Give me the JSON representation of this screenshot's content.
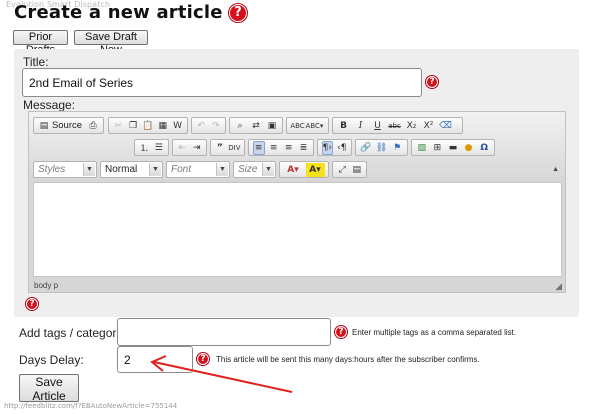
{
  "page": {
    "title": "Create a new article",
    "watermark": "Evolution Smart Dispatch",
    "url": "http://feedblitz.com/f?EBAutoNewArticle=755144"
  },
  "buttons": {
    "prior_drafts": "Prior Drafts",
    "save_draft": "Save Draft Now",
    "save_article": "Save Article"
  },
  "form": {
    "title_label": "Title:",
    "title_value": "2nd Email of Series",
    "message_label": "Message:",
    "tags_label": "Add tags / categories:",
    "tags_value": "",
    "tags_hint": "Enter multiple tags as a comma separated list.",
    "delay_label": "Days Delay:",
    "delay_value": "2",
    "delay_hint": "This article will be sent this many days:hours after the subscriber confirms."
  },
  "editor": {
    "source_label": "Source",
    "styles_placeholder": "Styles",
    "format_value": "Normal",
    "font_placeholder": "Font",
    "size_placeholder": "Size",
    "status_path": "body  p",
    "toolbar_row1": [
      "source-icon",
      "preview-icon",
      "cut-icon",
      "copy-icon",
      "paste-icon",
      "paste-text-icon",
      "paste-word-icon",
      "undo-icon",
      "redo-icon",
      "find-icon",
      "replace-icon",
      "select-all-icon",
      "spellcheck-icon",
      "spellcheck-dropdown-icon",
      "bold-icon",
      "italic-icon",
      "underline-icon",
      "strikethrough-icon",
      "subscript-icon",
      "superscript-icon",
      "remove-format-icon"
    ],
    "toolbar_row2": [
      "numbered-list-icon",
      "bulleted-list-icon",
      "outdent-icon",
      "indent-icon",
      "blockquote-icon",
      "div-icon",
      "align-left-icon",
      "align-center-icon",
      "align-right-icon",
      "justify-icon",
      "ltr-icon",
      "rtl-icon",
      "link-icon",
      "unlink-icon",
      "anchor-icon",
      "image-icon",
      "table-icon",
      "horizontal-line-icon",
      "smiley-icon",
      "special-char-icon"
    ],
    "toolbar_row3": [
      "text-color-icon",
      "background-color-icon",
      "maximize-icon",
      "show-blocks-icon"
    ]
  },
  "colors": {
    "help_red": "#d6101b",
    "arrow_red": "#e0201c",
    "panel_bg": "#eeeeee"
  }
}
